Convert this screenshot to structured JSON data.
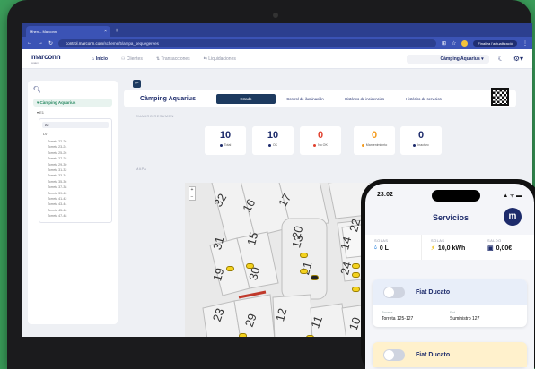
{
  "browser": {
    "tab_title": "Mhen – Marconn",
    "url_domain": "control.marconn.com",
    "url_path": "/scheme/5/ampa_sequegerees",
    "finish_label": "Finaliza l'actualització"
  },
  "app": {
    "logo": "marconn",
    "logo_sub": "system",
    "nav": [
      {
        "label": "Inicio",
        "active": true
      },
      {
        "label": "Clientes",
        "active": false
      },
      {
        "label": "Transacciones",
        "active": false
      },
      {
        "label": "Liquidaciones",
        "active": false
      }
    ],
    "site_selector": "Càmping Aquarius"
  },
  "sidebar": {
    "site": "Càmping Aquarius",
    "sub": "E1",
    "select": "All",
    "group": "LV",
    "items": [
      "Torreta 22-26",
      "Torreta 23-24",
      "Torreta 25-26",
      "Torreta 27-28",
      "Torreta 29-30",
      "Torreta 31-32",
      "Torreta 33-34",
      "Torreta 35-36",
      "Torreta 37-38",
      "Torreta 39-40",
      "Torreta 41-42",
      "Torreta 43-44",
      "Torreta 45-46",
      "Torreta 47-48"
    ]
  },
  "main": {
    "title": "Càmping Aquarius",
    "tabs": [
      {
        "label": "Estado",
        "active": true
      },
      {
        "label": "Control de iluminación",
        "active": false
      },
      {
        "label": "Histórico de incidencias",
        "active": false
      },
      {
        "label": "Histórico de servicios",
        "active": false
      }
    ],
    "section_summary": "CUADRO RESUMEN",
    "section_map": "MAPA",
    "counters": [
      {
        "num": "10",
        "label": "Total",
        "color": "#1d2b6b"
      },
      {
        "num": "10",
        "label": "OK",
        "color": "#1d2b6b"
      },
      {
        "num": "0",
        "label": "No OK",
        "color": "#e0412f"
      },
      {
        "num": "0",
        "label": "Mantenimiento",
        "color": "#f39a1c"
      },
      {
        "num": "0",
        "label": "Inactivo",
        "color": "#1d2b6b"
      }
    ],
    "zoom_in": "+",
    "zoom_out": "−"
  },
  "map": {
    "plots": [
      "32",
      "16",
      "17",
      "31",
      "15",
      "20",
      "19",
      "30",
      "14",
      "24",
      "23",
      "29",
      "13",
      "21",
      "22",
      "12",
      "11",
      "10"
    ]
  },
  "phone": {
    "time": "23:02",
    "status": "▲ ᯤ ▬",
    "title": "Servicios",
    "avatar": "m",
    "stats": [
      {
        "key": "SOLAS",
        "value": "0 L",
        "icon": "water-drop-icon"
      },
      {
        "key": "SOLAS",
        "value": "10,0 kWh",
        "icon": "lightning-icon"
      },
      {
        "key": "SALDO",
        "value": "0,00€",
        "icon": "wallet-icon"
      }
    ],
    "cards": [
      {
        "name": "Fiat Ducato",
        "k1": "Torreta",
        "v1": "Torreta 125-127",
        "k2": "Ent.",
        "v2": "Suministro 127"
      },
      {
        "name": "Fiat Ducato"
      }
    ]
  }
}
